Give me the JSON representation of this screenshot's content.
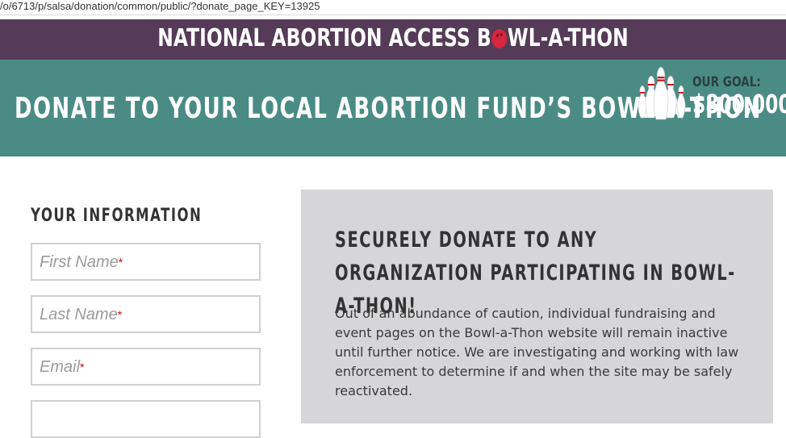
{
  "browser": {
    "url": "/o/6713/p/salsa/donation/common/public/?donate_page_KEY=13925"
  },
  "header": {
    "title_before": "NATIONAL ABORTION ACCESS B",
    "title_after": "WL-A-THON",
    "ball_icon": "bowling-ball-icon",
    "color": "#553b57"
  },
  "banner": {
    "headline": "DONATE TO YOUR LOCAL ABORTION FUND’S BOWL-A-THON",
    "goal_label": "OUR GOAL:",
    "goal_value": "$800,000",
    "pins_icon": "bowling-pins-icon",
    "color": "#4a8c84"
  },
  "form": {
    "section_title": "YOUR INFORMATION",
    "first_name_placeholder": "First Name",
    "last_name_placeholder": "Last Name",
    "email_placeholder": "Email",
    "required_mark": "*"
  },
  "panel": {
    "heading": "SECURELY DONATE TO ANY ORGANIZATION PARTICIPATING IN BOWL-A-THON!",
    "body": "Out of an abundance of caution, individual fundraising and event pages on the Bowl-a-Thon website will remain inactive until further notice. We are investigating and working with law enforcement to determine if and when the site may be safely reactivated."
  }
}
